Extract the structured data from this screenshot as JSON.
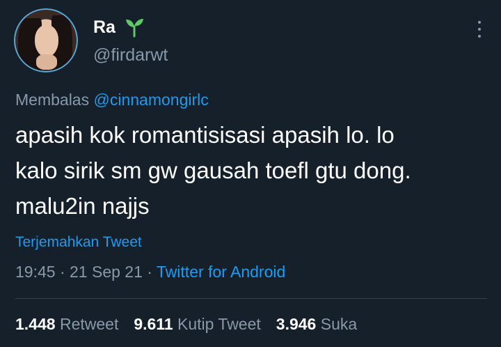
{
  "user": {
    "name": "Ra",
    "handle": "@firdarwt"
  },
  "reply": {
    "prefix": "Membalas",
    "mention": "@cinnamongirlc"
  },
  "tweet": {
    "text": "apasih kok romantisisasi apasih lo. lo\nkalo sirik sm gw gausah toefl gtu dong.\nmalu2in najjs",
    "translate_label": "Terjemahkan Tweet",
    "time": "19:45",
    "date": "21 Sep 21",
    "source": "Twitter for Android"
  },
  "stats": {
    "retweets": "1.448",
    "retweets_label": "Retweet",
    "quotes": "9.611",
    "quotes_label": "Kutip Tweet",
    "likes": "3.946",
    "likes_label": "Suka"
  },
  "colors": {
    "background": "#15202b",
    "accent": "#1d9bf0",
    "muted": "#8b98a5",
    "sprout": "#5fc96a"
  },
  "icons": {
    "name_emoji": "seedling-icon",
    "menu": "more-options-icon"
  }
}
